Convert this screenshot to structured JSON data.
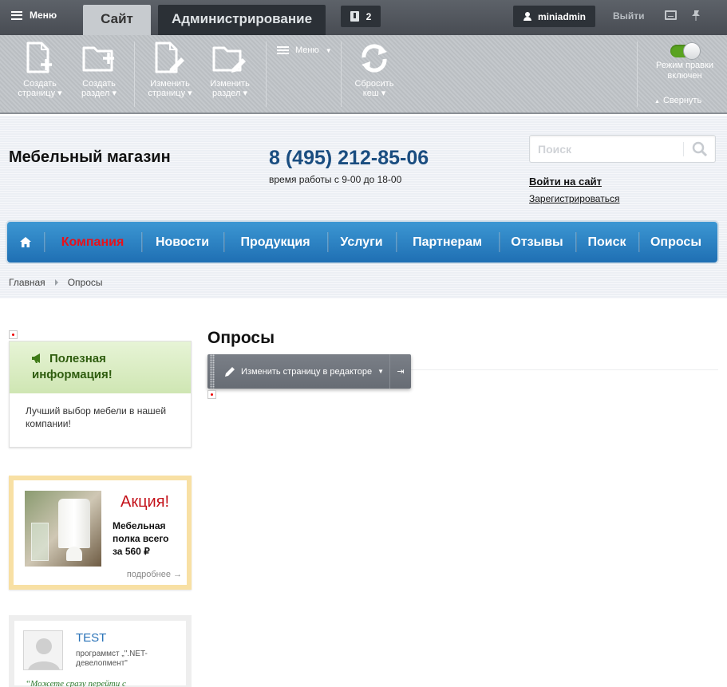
{
  "admin": {
    "menu_label": "Меню",
    "tab_site": "Сайт",
    "tab_admin": "Администрирование",
    "notifications": "2",
    "user": "miniadmin",
    "logout": "Выйти"
  },
  "toolbar": {
    "create_page": [
      "Создать",
      "страницу ▾"
    ],
    "create_section": [
      "Создать",
      "раздел ▾"
    ],
    "edit_page": [
      "Изменить",
      "страницу ▾"
    ],
    "edit_section": [
      "Изменить",
      "раздел ▾"
    ],
    "menu": "Меню",
    "reset_cache": [
      "Сбросить",
      "кеш ▾"
    ],
    "edit_mode": [
      "Режим правки",
      "включен"
    ],
    "collapse": "Свернуть"
  },
  "header": {
    "logo": "Мебельный магазин",
    "phone": "8 (495) 212-85-06",
    "hours": "время работы с 9-00 до 18-00",
    "search_placeholder": "Поиск",
    "login": "Войти на сайт",
    "register": "Зарегистрироваться"
  },
  "nav": {
    "items": [
      "Компания",
      "Новости",
      "Продукция",
      "Услуги",
      "Партнерам",
      "Отзывы",
      "Поиск",
      "Опросы"
    ],
    "active": "Компания"
  },
  "breadcrumbs": [
    "Главная",
    "Опросы"
  ],
  "sidebar": {
    "info_title": "Полезная информация!",
    "info_text": "Лучший выбор мебели в нашей компании!",
    "promo_title": "Акция!",
    "promo_text": "Мебельная полка всего за 560 ₽",
    "promo_more": "подробнее →",
    "review_name": "TEST",
    "review_role": "программст „\".NET-девелопмент\"",
    "review_quote": "“Можете сразу перейти с"
  },
  "main": {
    "title": "Опросы",
    "edit_action": "Изменить страницу в редакторе"
  },
  "colors": {
    "nav_blue": "#2a82c4",
    "nav_active": "#e6121c",
    "phone": "#1a4d80",
    "info_green": "#2f5d0f",
    "promo_red": "#c4121a"
  }
}
